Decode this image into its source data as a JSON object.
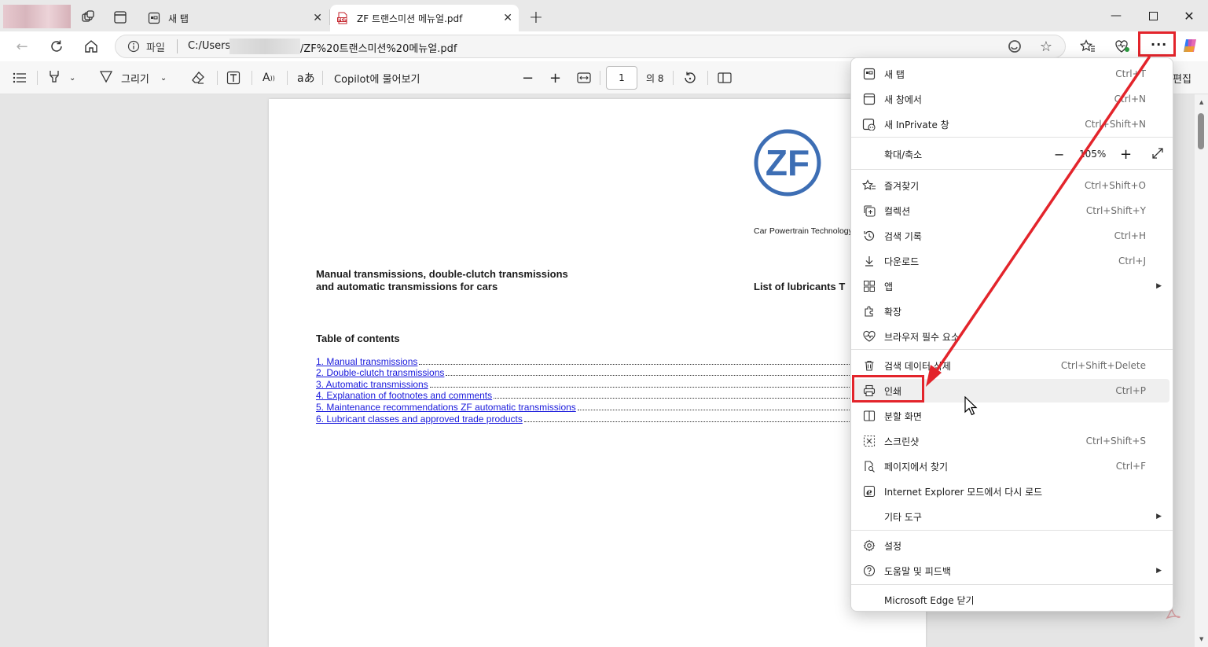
{
  "tabs": [
    {
      "label": "새 탭",
      "icon": "new-tab-icon"
    },
    {
      "label": "ZF 트랜스미션 메뉴얼.pdf",
      "icon": "pdf-icon"
    }
  ],
  "address": {
    "scheme_label": "파일",
    "url_prefix": "C:/Users/",
    "url_suffix": "/ZF%20트랜스미션%20메뉴얼.pdf"
  },
  "pdf_toolbar": {
    "draw_label": "그리기",
    "copilot_label": "Copilot에 물어보기",
    "page_current": "1",
    "page_total": "의 8",
    "edit_label": "편집"
  },
  "document": {
    "logo_text": "ZF",
    "tagline": "Car Powertrain Technology",
    "heading_line1": "Manual transmissions, double-clutch transmissions",
    "heading_line2": "and automatic transmissions for cars",
    "right_heading": "List of lubricants T",
    "toc_title": "Table of contents",
    "toc": [
      "1. Manual transmissions",
      "2. Double-clutch transmissions",
      "3. Automatic transmissions",
      "4. Explanation of footnotes and comments",
      "5. Maintenance recommendations ZF automatic transmissions",
      "6. Lubricant classes and approved trade products"
    ]
  },
  "menu": {
    "zoom_label": "확대/축소",
    "zoom_value": "105%",
    "items": [
      {
        "label": "새 탭",
        "shortcut": "Ctrl+T",
        "icon": "new-tab-icon"
      },
      {
        "label": "새 창에서",
        "shortcut": "Ctrl+N",
        "icon": "window-icon"
      },
      {
        "label": "새 InPrivate 창",
        "shortcut": "Ctrl+Shift+N",
        "icon": "inprivate-icon"
      },
      {
        "label": "즐겨찾기",
        "shortcut": "Ctrl+Shift+O",
        "icon": "favorites-icon"
      },
      {
        "label": "컬렉션",
        "shortcut": "Ctrl+Shift+Y",
        "icon": "collections-icon"
      },
      {
        "label": "검색 기록",
        "shortcut": "Ctrl+H",
        "icon": "history-icon"
      },
      {
        "label": "다운로드",
        "shortcut": "Ctrl+J",
        "icon": "download-icon"
      },
      {
        "label": "앱",
        "shortcut": "",
        "icon": "apps-icon"
      },
      {
        "label": "확장",
        "shortcut": "",
        "icon": "extensions-icon"
      },
      {
        "label": "브라우저 필수 요소",
        "shortcut": "",
        "icon": "heartbeat-icon"
      },
      {
        "label": "검색 데이터 삭제",
        "shortcut": "Ctrl+Shift+Delete",
        "icon": "trash-icon"
      },
      {
        "label": "인쇄",
        "shortcut": "Ctrl+P",
        "icon": "printer-icon"
      },
      {
        "label": "분할 화면",
        "shortcut": "",
        "icon": "split-screen-icon"
      },
      {
        "label": "스크린샷",
        "shortcut": "Ctrl+Shift+S",
        "icon": "screenshot-icon"
      },
      {
        "label": "페이지에서 찾기",
        "shortcut": "Ctrl+F",
        "icon": "find-icon"
      },
      {
        "label": "Internet Explorer 모드에서 다시 로드",
        "shortcut": "",
        "icon": "ie-icon"
      },
      {
        "label": "기타 도구",
        "shortcut": "",
        "icon": "none"
      },
      {
        "label": "설정",
        "shortcut": "",
        "icon": "gear-icon"
      },
      {
        "label": "도움말 및 피드백",
        "shortcut": "",
        "icon": "help-icon"
      },
      {
        "label": "Microsoft Edge 닫기",
        "shortcut": "",
        "icon": "none"
      }
    ]
  },
  "colors": {
    "highlight": "#e3242b",
    "link": "#1a1adc",
    "zf_blue": "#3d6eb4"
  }
}
